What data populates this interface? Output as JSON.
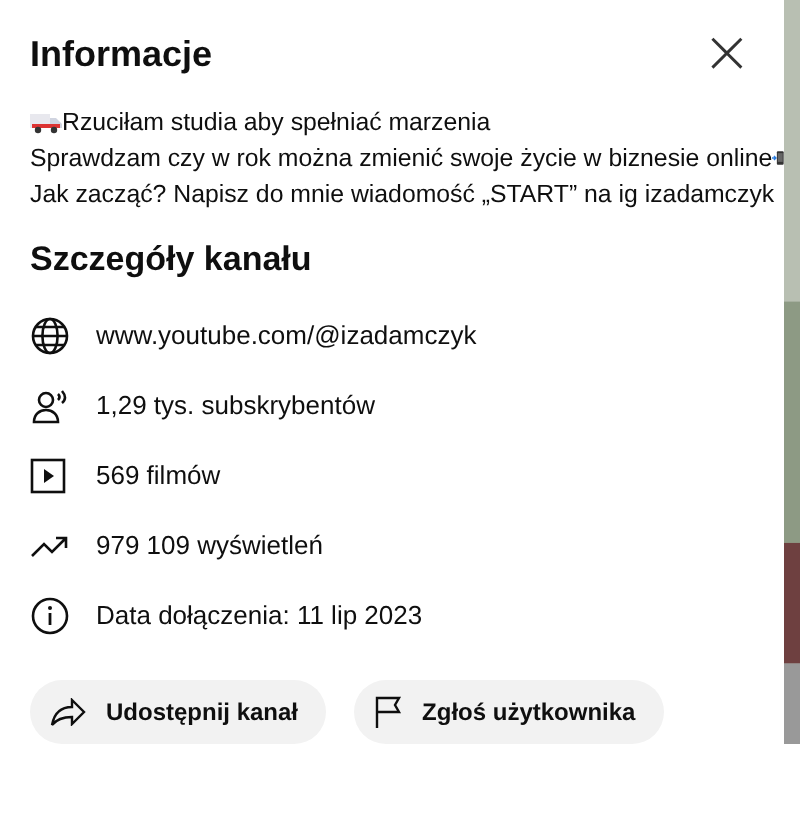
{
  "dialog": {
    "title": "Informacje",
    "close": "×"
  },
  "description": [
    "Rzuciłam studia aby spełniać marzenia",
    "Sprawdzam czy w rok można zmienić swoje życie w biznesie online",
    "Jak zacząć? Napisz do mnie wiadomość „START” na ig izadamczyk"
  ],
  "details": {
    "heading": "Szczegóły kanału",
    "rows": [
      {
        "kind": "link",
        "text": "www.youtube.com/@izadamczyk"
      },
      {
        "kind": "subscribers",
        "text": "1,29 tys. subskrybentów"
      },
      {
        "kind": "videos",
        "text": "569 filmów"
      },
      {
        "kind": "views",
        "text": "979 109 wyświetleń"
      },
      {
        "kind": "joined",
        "text": "Data dołączenia: 11 lip 2023"
      }
    ]
  },
  "buttons": [
    {
      "kind": "share",
      "label": "Udostępnij kanał"
    },
    {
      "kind": "report",
      "label": "Zgłoś użytkownika"
    }
  ]
}
